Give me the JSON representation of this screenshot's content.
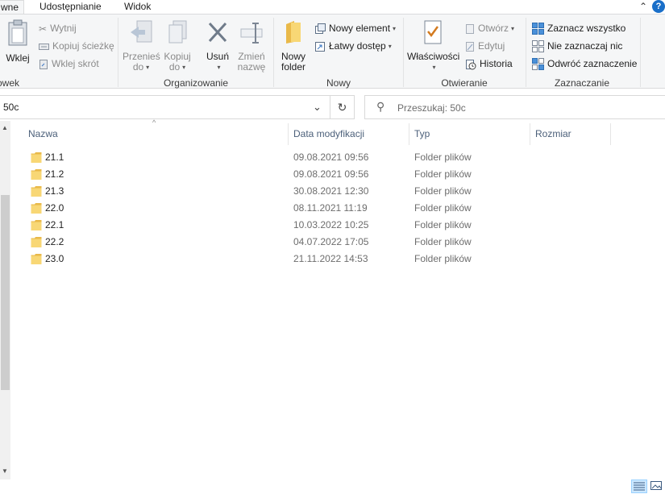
{
  "tabs": [
    {
      "label": "wne",
      "active": true
    },
    {
      "label": "Udostępnianie",
      "active": false
    },
    {
      "label": "Widok",
      "active": false
    }
  ],
  "help_label": "?",
  "ribbon": {
    "clipboard": {
      "group_label": "owek",
      "paste_label": "Wklej",
      "cut_label": "Wytnij",
      "copy_path_label": "Kopiuj ścieżkę",
      "paste_shortcut_label": "Wklej skrót"
    },
    "organize": {
      "group_label": "Organizowanie",
      "move_to_line1": "Przenieś",
      "move_to_line2": "do",
      "copy_to_line1": "Kopiuj",
      "copy_to_line2": "do",
      "delete_label": "Usuń",
      "rename_line1": "Zmień",
      "rename_line2": "nazwę"
    },
    "new": {
      "group_label": "Nowy",
      "new_folder_line1": "Nowy",
      "new_folder_line2": "folder",
      "new_item_label": "Nowy element",
      "easy_access_label": "Łatwy dostęp"
    },
    "open": {
      "group_label": "Otwieranie",
      "properties_label": "Właściwości",
      "open_label": "Otwórz",
      "edit_label": "Edytuj",
      "history_label": "Historia"
    },
    "select": {
      "group_label": "Zaznaczanie",
      "select_all_label": "Zaznacz wszystko",
      "select_none_label": "Nie zaznaczaj nic",
      "invert_label": "Odwróć zaznaczenie"
    }
  },
  "address": {
    "path": "50c",
    "search_placeholder": "Przeszukaj: 50c"
  },
  "columns": {
    "name": "Nazwa",
    "date": "Data modyfikacji",
    "type": "Typ",
    "size": "Rozmiar"
  },
  "rows": [
    {
      "name": "21.1",
      "date": "09.08.2021 09:56",
      "type": "Folder plików",
      "size": ""
    },
    {
      "name": "21.2",
      "date": "09.08.2021 09:56",
      "type": "Folder plików",
      "size": ""
    },
    {
      "name": "21.3",
      "date": "30.08.2021 12:30",
      "type": "Folder plików",
      "size": ""
    },
    {
      "name": "22.0",
      "date": "08.11.2021 11:19",
      "type": "Folder plików",
      "size": ""
    },
    {
      "name": "22.1",
      "date": "10.03.2022 10:25",
      "type": "Folder plików",
      "size": ""
    },
    {
      "name": "22.2",
      "date": "04.07.2022 17:05",
      "type": "Folder plików",
      "size": ""
    },
    {
      "name": "23.0",
      "date": "21.11.2022 14:53",
      "type": "Folder plików",
      "size": ""
    }
  ],
  "colors": {
    "accent": "#1a6fc9",
    "folder": "#f8d775",
    "ribbon_bg": "#f5f6f7"
  }
}
